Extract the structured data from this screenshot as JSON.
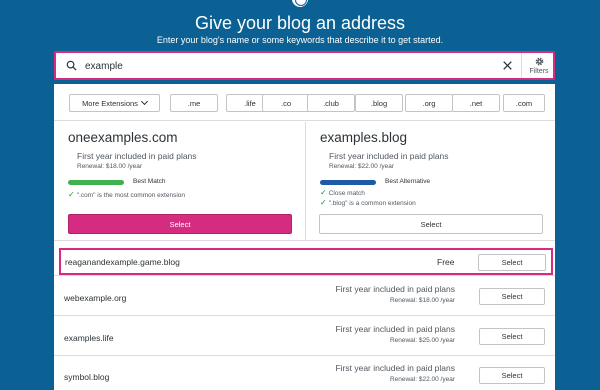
{
  "header": {
    "logo_icon": "wordpress-logo-icon",
    "title": "Give your blog an address",
    "subtitle": "Enter your blog's name or some keywords that describe it to get started."
  },
  "search": {
    "value": "example",
    "search_icon": "search-icon",
    "clear_icon": "close-icon",
    "filters_icon": "gear-icon",
    "filters_label": "Filters"
  },
  "extensions": {
    "more_label": "More Extensions",
    "items": [
      ".me",
      ".life",
      ".co",
      ".club",
      ".blog",
      ".org",
      ".net",
      ".com"
    ]
  },
  "featured": [
    {
      "domain": "oneexamples.com",
      "included": "First year included in paid plans",
      "renewal": "Renewal: $18.00 /year",
      "badge": "Best Match",
      "badge_color": "#3fb24f",
      "check": "\".com\" is the most common extension",
      "select_label": "Select"
    },
    {
      "domain": "examples.blog",
      "included": "First year included in paid plans",
      "renewal": "Renewal: $22.00 /year",
      "badge": "Best Alternative",
      "badge_color": "#1d5aa8",
      "checks": [
        "Close match",
        "\".blog\" is a common extension"
      ],
      "select_label": "Select"
    }
  ],
  "highlighted_result": {
    "domain": "reaganandexample.game.blog",
    "price": "Free",
    "select_label": "Select"
  },
  "results": [
    {
      "domain": "webexample.org",
      "included": "First year included in paid plans",
      "renewal": "Renewal: $18.00 /year",
      "select_label": "Select"
    },
    {
      "domain": "examples.life",
      "included": "First year included in paid plans",
      "renewal": "Renewal: $25.00 /year",
      "select_label": "Select"
    },
    {
      "domain": "symbol.blog",
      "included": "First year included in paid plans",
      "renewal": "Renewal: $22.00 /year",
      "select_label": "Select"
    }
  ],
  "colors": {
    "background": "#0b6193",
    "accent": "#d52c82"
  }
}
